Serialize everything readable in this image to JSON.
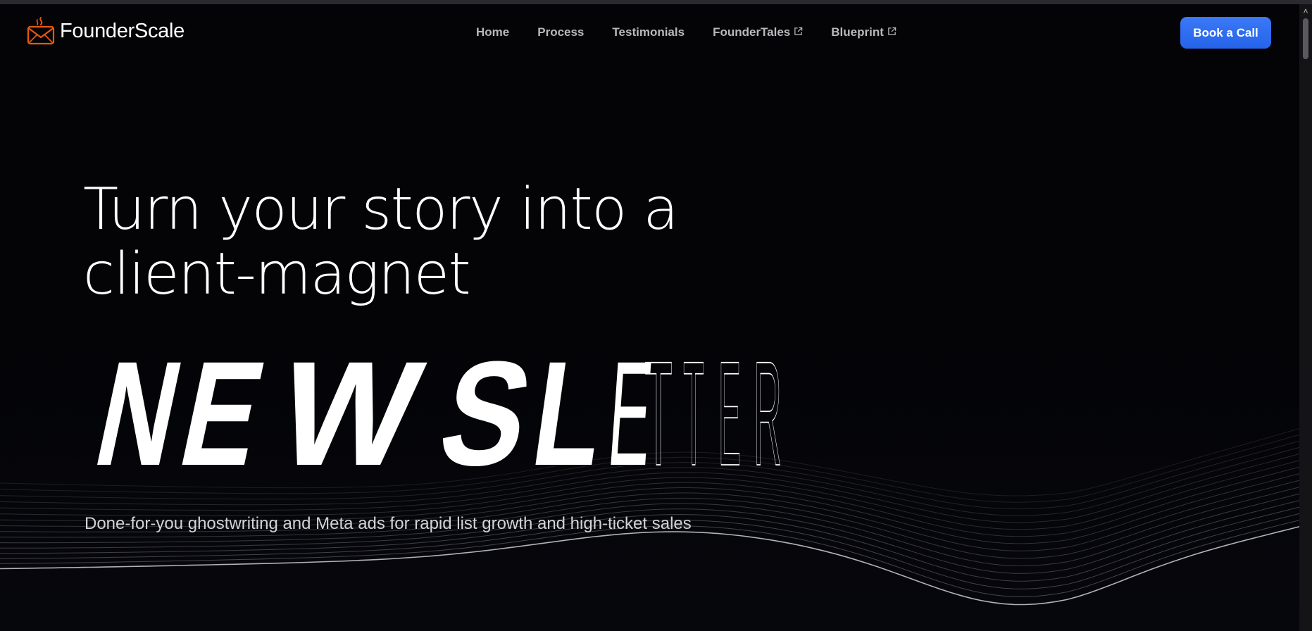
{
  "brand": {
    "name": "FounderScale",
    "logo_icon": "envelope-flame-icon",
    "accent": "#ea580c"
  },
  "nav": {
    "links": [
      {
        "label": "Home",
        "external": false
      },
      {
        "label": "Process",
        "external": false
      },
      {
        "label": "Testimonials",
        "external": false
      },
      {
        "label": "FounderTales",
        "external": true
      },
      {
        "label": "Blueprint",
        "external": true
      }
    ],
    "cta_label": "Book a Call",
    "cta_color": "#2563eb"
  },
  "hero": {
    "title_line1": "Turn your story into a",
    "title_line2": "client-magnet",
    "highlight_word": "NEWSLETTER",
    "subtitle": "Done-for-you ghostwriting and Meta ads for rapid list growth and high-ticket sales"
  },
  "colors": {
    "background": "#050509",
    "text": "#ffffff",
    "muted": "#b8b8bd"
  }
}
